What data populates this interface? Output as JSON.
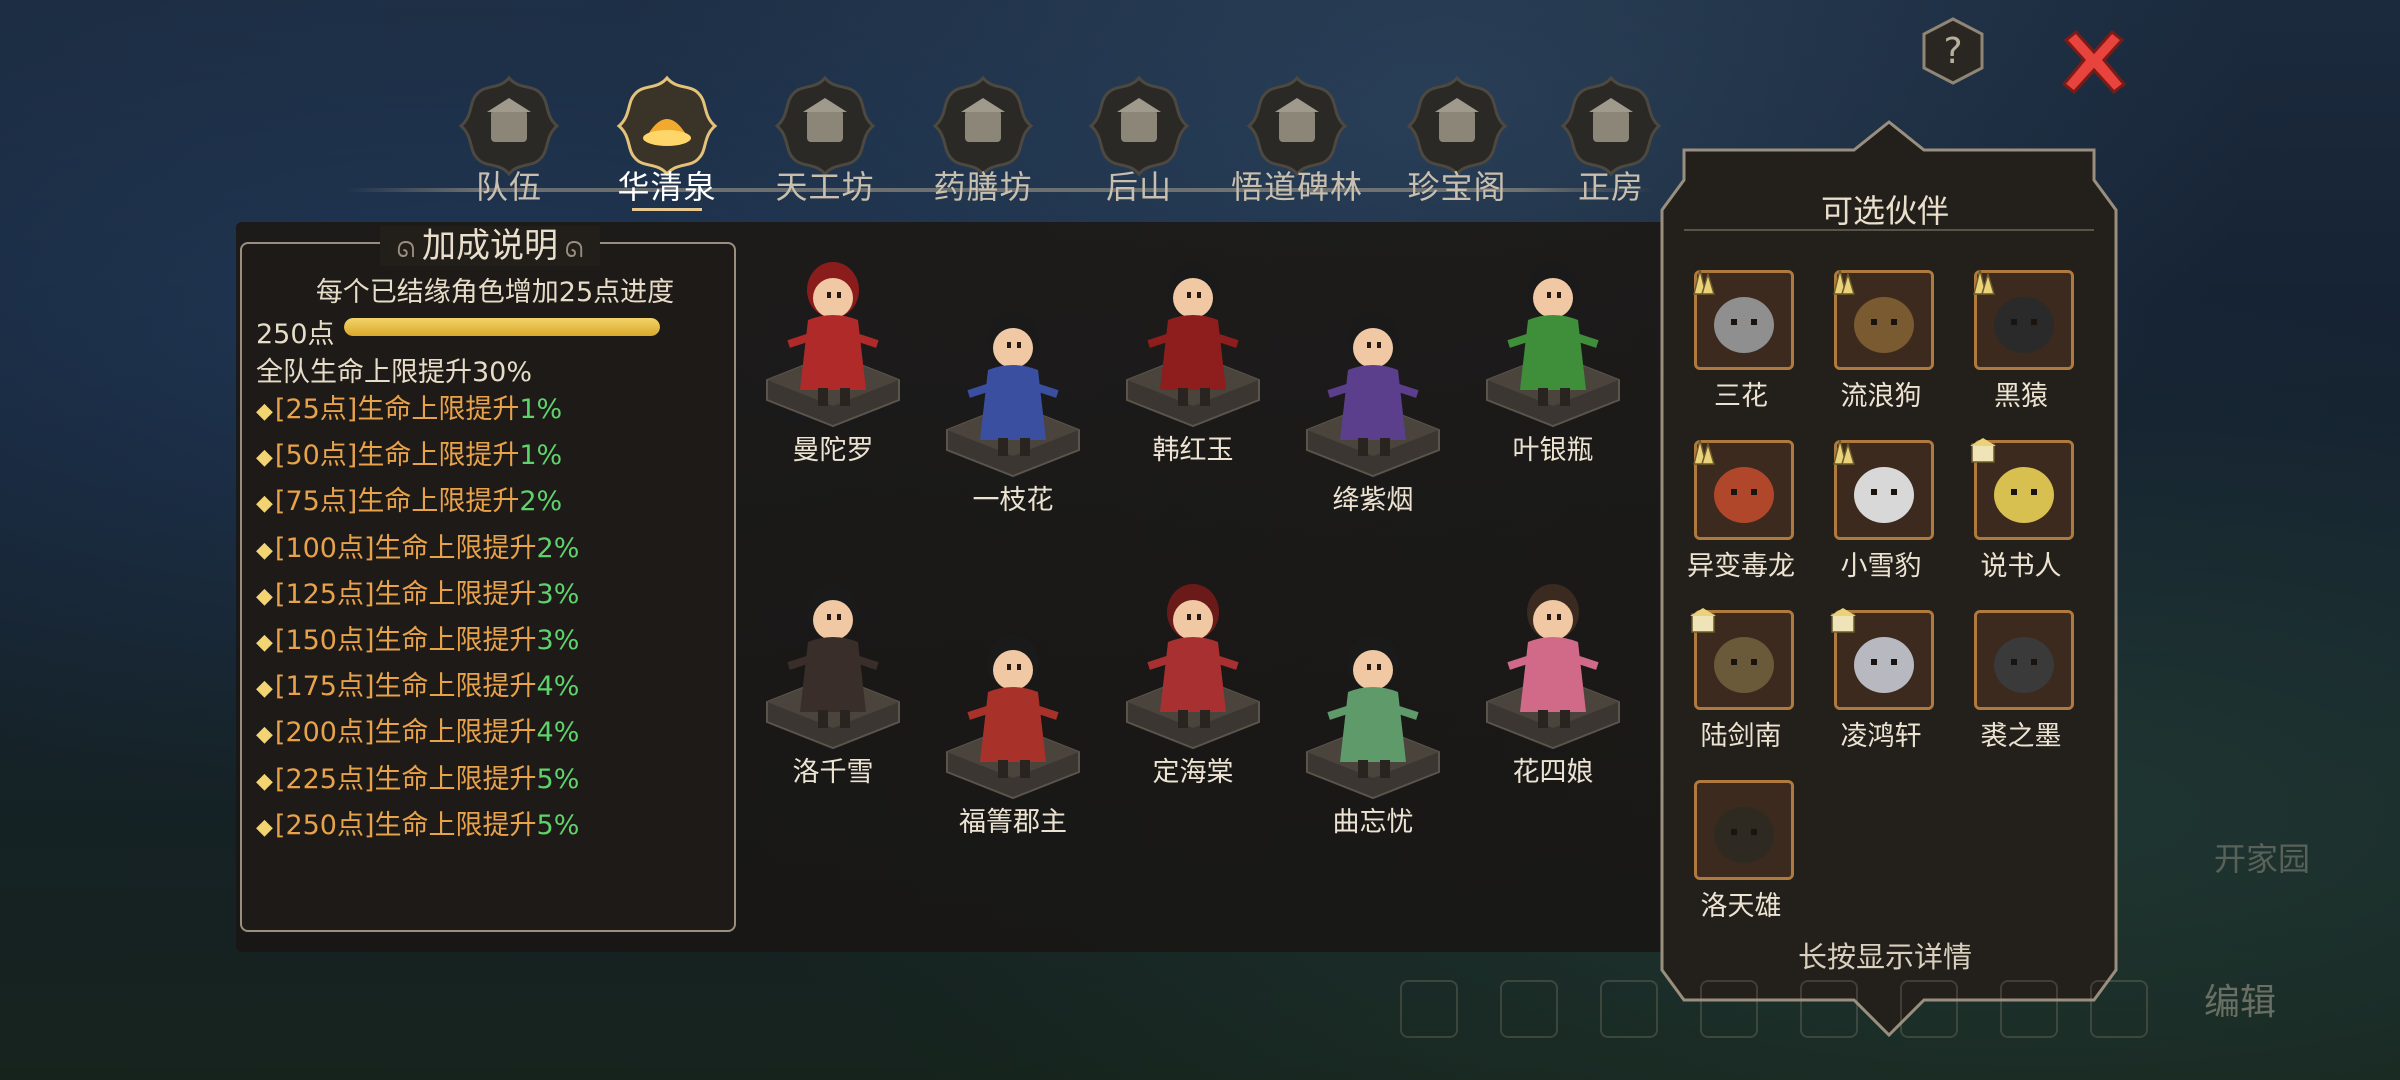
{
  "header": {
    "help_icon": "question-icon",
    "close_icon": "close-icon",
    "tabs": [
      {
        "label": "队伍",
        "icon": "team-icon",
        "active": false
      },
      {
        "label": "华清泉",
        "icon": "hot-spring-icon",
        "active": true
      },
      {
        "label": "天工坊",
        "icon": "workshop-icon",
        "active": false
      },
      {
        "label": "药膳坊",
        "icon": "kitchen-icon",
        "active": false
      },
      {
        "label": "后山",
        "icon": "mountain-icon",
        "active": false
      },
      {
        "label": "悟道碑林",
        "icon": "stele-icon",
        "active": false
      },
      {
        "label": "珍宝阁",
        "icon": "pavilion-icon",
        "active": false
      },
      {
        "label": "正房",
        "icon": "house-icon",
        "active": false
      }
    ]
  },
  "bonus": {
    "title": "加成说明",
    "description": "每个已结缘角色增加25点进度",
    "points": "250点",
    "progress": 1.0,
    "total": "全队生命上限提升30%",
    "items": [
      {
        "label": "[25点]生命上限提升",
        "value": "1%"
      },
      {
        "label": "[50点]生命上限提升",
        "value": "1%"
      },
      {
        "label": "[75点]生命上限提升",
        "value": "2%"
      },
      {
        "label": "[100点]生命上限提升",
        "value": "2%"
      },
      {
        "label": "[125点]生命上限提升",
        "value": "3%"
      },
      {
        "label": "[150点]生命上限提升",
        "value": "3%"
      },
      {
        "label": "[175点]生命上限提升",
        "value": "4%"
      },
      {
        "label": "[200点]生命上限提升",
        "value": "4%"
      },
      {
        "label": "[225点]生命上限提升",
        "value": "5%"
      },
      {
        "label": "[250点]生命上限提升",
        "value": "5%"
      }
    ]
  },
  "characters": [
    {
      "name": "曼陀罗",
      "hair": "#8b1c1c",
      "robe": "#b02a2a"
    },
    {
      "name": "一枝花",
      "hair": "#1a1a1a",
      "robe": "#3b4fa0"
    },
    {
      "name": "韩红玉",
      "hair": "#1a1a1a",
      "robe": "#8e1e1e"
    },
    {
      "name": "绛紫烟",
      "hair": "#1a1a1a",
      "robe": "#5b3f8c"
    },
    {
      "name": "叶银瓶",
      "hair": "#1a1a1a",
      "robe": "#3f8f3a"
    },
    {
      "name": "洛千雪",
      "hair": "#1a1a1a",
      "robe": "#3a2e2a"
    },
    {
      "name": "福箐郡主",
      "hair": "#1a1a1a",
      "robe": "#a8322a"
    },
    {
      "name": "定海棠",
      "hair": "#6b1a1a",
      "robe": "#a83030"
    },
    {
      "name": "曲忘忧",
      "hair": "#1a1a1a",
      "robe": "#5f9a6a"
    },
    {
      "name": "花四娘",
      "hair": "#3a2a20",
      "robe": "#d06a88"
    }
  ],
  "partners": {
    "title": "可选伙伴",
    "hint": "长按显示详情",
    "items": [
      {
        "name": "三花",
        "tag": "rank-icon",
        "portrait": "cat-icon",
        "color": "#8f8f8f"
      },
      {
        "name": "流浪狗",
        "tag": "rank-icon",
        "portrait": "dog-icon",
        "color": "#7a5a30"
      },
      {
        "name": "黑猿",
        "tag": "rank-icon",
        "portrait": "ape-icon",
        "color": "#2a2a2a"
      },
      {
        "name": "异变毒龙",
        "tag": "rank-icon",
        "portrait": "lizard-icon",
        "color": "#b0472a"
      },
      {
        "name": "小雪豹",
        "tag": "rank-icon",
        "portrait": "leopard-icon",
        "color": "#d8d8d8"
      },
      {
        "name": "说书人",
        "tag": "book-icon",
        "portrait": "storyteller-icon",
        "color": "#d8c050"
      },
      {
        "name": "陆剑南",
        "tag": "book-icon",
        "portrait": "swordsman-icon",
        "color": "#6a5a3a"
      },
      {
        "name": "凌鸿轩",
        "tag": "house-tag-icon",
        "portrait": "elder-icon",
        "color": "#b8b8c0"
      },
      {
        "name": "裘之墨",
        "tag": "none",
        "portrait": "masked-icon",
        "color": "#3a3a3a"
      },
      {
        "name": "洛天雄",
        "tag": "none",
        "portrait": "general-icon",
        "color": "#2e2a22"
      }
    ]
  },
  "background_ui": {
    "faded_button": "开家园",
    "edit_button": "编辑"
  }
}
